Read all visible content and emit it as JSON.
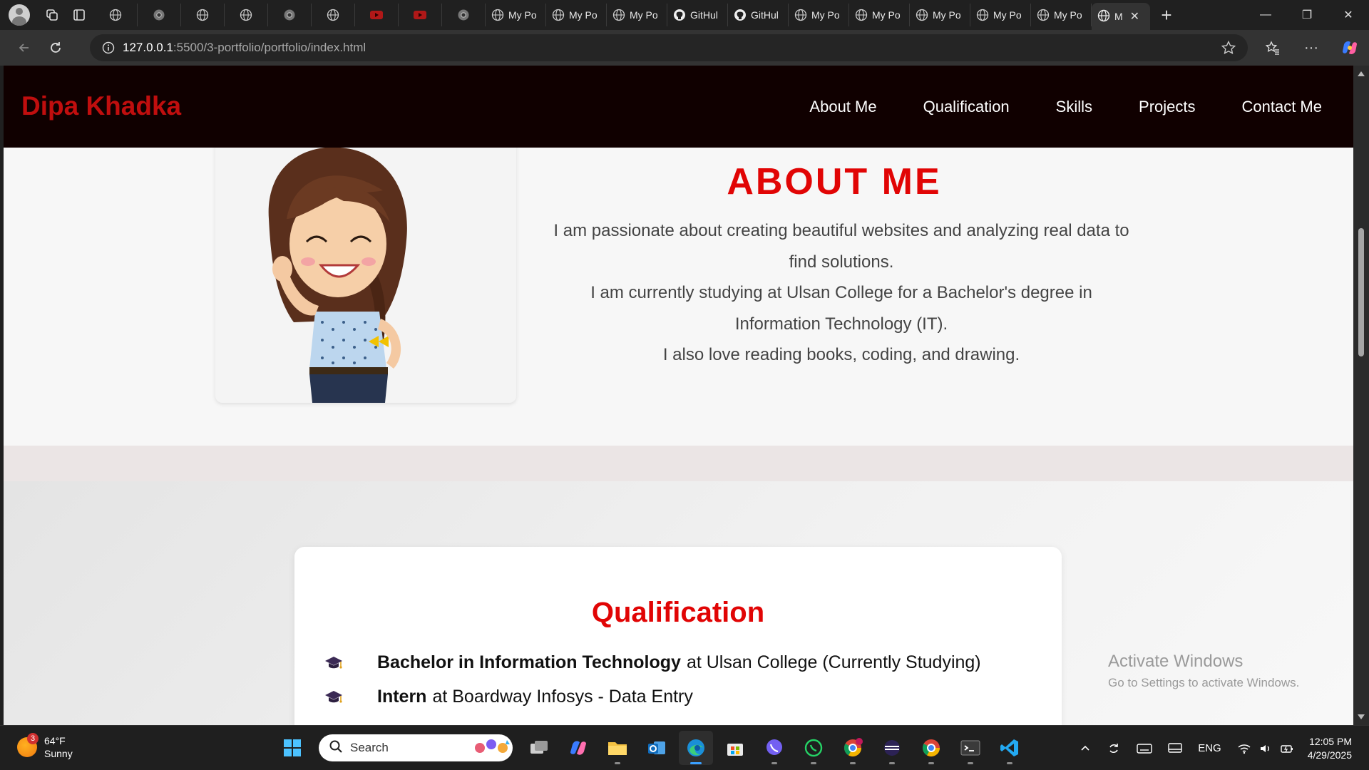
{
  "browser": {
    "tabs": [
      {
        "icon": "globe-icon",
        "title": ""
      },
      {
        "icon": "chrome-tab-icon",
        "title": ""
      },
      {
        "icon": "globe-icon",
        "title": ""
      },
      {
        "icon": "globe-icon",
        "title": ""
      },
      {
        "icon": "chrome-tab-icon",
        "title": ""
      },
      {
        "icon": "globe-icon",
        "title": ""
      },
      {
        "icon": "youtube-icon",
        "title": ""
      },
      {
        "icon": "youtube-icon",
        "title": ""
      },
      {
        "icon": "chrome-tab-icon",
        "title": ""
      },
      {
        "icon": "globe-icon",
        "title": "My Po"
      },
      {
        "icon": "globe-icon",
        "title": "My Po"
      },
      {
        "icon": "globe-icon",
        "title": "My Po"
      },
      {
        "icon": "github-icon",
        "title": "GitHul"
      },
      {
        "icon": "github-icon",
        "title": "GitHul"
      },
      {
        "icon": "globe-icon",
        "title": "My Po"
      },
      {
        "icon": "globe-icon",
        "title": "My Po"
      },
      {
        "icon": "globe-icon",
        "title": "My Po"
      },
      {
        "icon": "globe-icon",
        "title": "My Po"
      },
      {
        "icon": "globe-icon",
        "title": "My Po"
      }
    ],
    "active_tab": {
      "title": "M",
      "close": "✕"
    },
    "new_tab": "+",
    "window_controls": {
      "minimize": "—",
      "maximize": "❐",
      "close": "✕"
    },
    "url": {
      "host": "127.0.0.1",
      "path": ":5500/3-portfolio/portfolio/index.html"
    },
    "toolbar_icons": {
      "favorites": "☆",
      "more": "···"
    }
  },
  "site": {
    "brand": "Dipa Khadka",
    "nav": [
      "About Me",
      "Qualification",
      "Skills",
      "Projects",
      "Contact Me"
    ],
    "about": {
      "title": "ABOUT ME",
      "lines": [
        "I am passionate about creating beautiful websites and analyzing real data to find solutions.",
        "I am currently studying at Ulsan College for a Bachelor's degree in Information Technology (IT).",
        "I also love reading books, coding, and drawing."
      ]
    },
    "qualification": {
      "title": "Qualification",
      "items": [
        {
          "strong": "Bachelor in Information Technology",
          "rest": "at Ulsan College (Currently Studying)"
        },
        {
          "strong": "Intern",
          "rest": "at Boardway Infosys - Data Entry"
        }
      ]
    }
  },
  "watermark": {
    "line1": "Activate Windows",
    "line2": "Go to Settings to activate Windows."
  },
  "taskbar": {
    "weather": {
      "temp": "64°F",
      "condition": "Sunny",
      "badge": "3"
    },
    "search_label": "Search",
    "tray": {
      "lang": "ENG"
    },
    "clock": {
      "time": "12:05 PM",
      "date": "4/29/2025"
    }
  },
  "colors": {
    "brand_red": "#c00e0e",
    "heading_red": "#e10505",
    "nav_bg": "#100000"
  }
}
